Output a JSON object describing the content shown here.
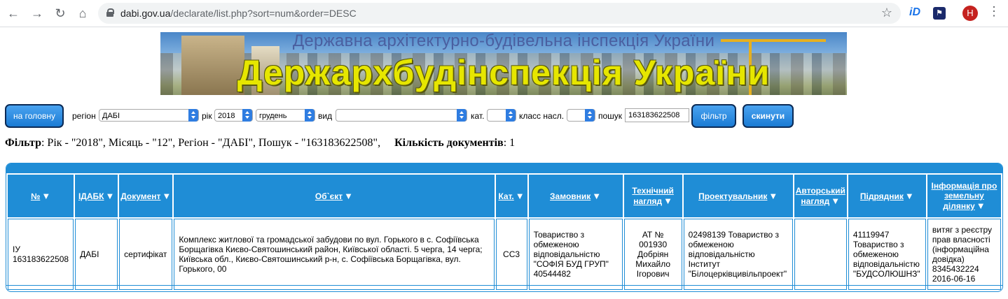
{
  "browser": {
    "url_host": "dabi.gov.ua",
    "url_path": "/declarate/list.php?sort=num&order=DESC",
    "ext_id_label": "iD",
    "avatar_letter": "H"
  },
  "banner": {
    "subtitle": "Державна архітектурно-будівельна інспекція України",
    "title": "Держархбудінспекція України"
  },
  "filters": {
    "home_button": "на головну",
    "region_label": "регіон",
    "region_value": "ДАБІ",
    "year_label": "рік",
    "year_value": "2018",
    "month_value": "грудень",
    "type_label": "вид",
    "type_value": "",
    "cat_label": "кат.",
    "cat_value": "",
    "class_label": "класс насл.",
    "class_value": "",
    "search_label": "пошук",
    "search_value": "163183622508",
    "filter_button": "фільтр",
    "reset_button": "скинути"
  },
  "summary": {
    "filter_label": "Фільтр",
    "filter_text": ": Рік - \"2018\", Місяць - \"12\", Регіон - \"ДАБІ\", Пошук - \"163183622508\",",
    "count_label": "Кількість документів",
    "count_value": ": 1"
  },
  "table": {
    "headers": [
      "№",
      "ІДАБК",
      "Документ",
      "Об`єкт",
      "Кат.",
      "Замовник",
      "Технічний нагляд",
      "Проектувальник",
      "Авторський нагляд",
      "Підрядник",
      "Інформація про земельну ділянку"
    ],
    "row": {
      "num": "ІУ 163183622508",
      "idabk": "ДАБІ",
      "doc": "сертифікат",
      "object": "Комплекс житлової та громадської забудови по вул. Горького в с. Софіївська Борщагівка Києво-Святошинський район, Київської області. 5 черга, 14 черга; Київська обл., Києво-Святошинський р-н, с. Софіївська Борщагівка, вул. Горького, 00",
      "cat": "СС3",
      "customer": "Товариство з обмеженою відповідальністю \"СОФІЯ БУД ГРУП\" 40544482",
      "tech": "АТ № 001930 Добріян Михайло Ігорович",
      "designer": "02498139 Товариство з обмеженою відповідальністю Інститут \"Білоцерківцивільпроект\"",
      "author": "",
      "contractor": "41119947 Товариство з обмеженою відповідальністю \"БУДСОЛЮШНЗ\"",
      "land": "витяг з реєстру прав власності (інформаційна довідка) 8345432224 2016-06-16"
    }
  }
}
